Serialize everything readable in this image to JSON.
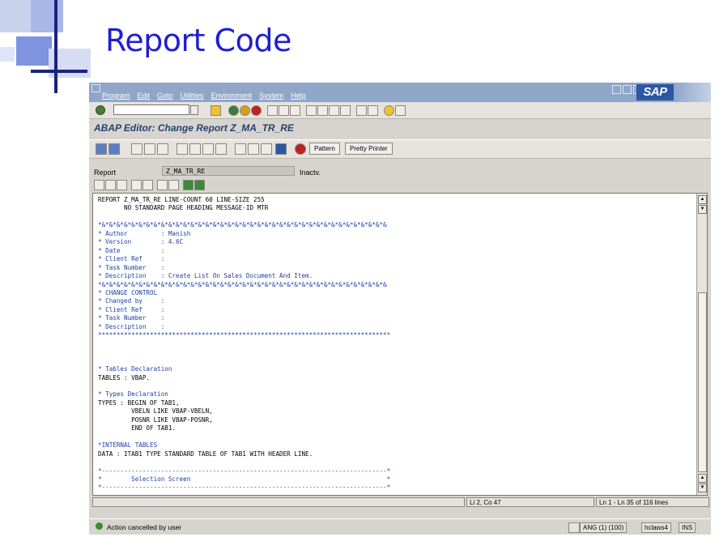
{
  "slide": {
    "title": "Report Code"
  },
  "menu": {
    "items": [
      "Program",
      "Edit",
      "Goto",
      "Utilities",
      "Environment",
      "System",
      "Help"
    ],
    "logo": "SAP"
  },
  "page": {
    "title": "ABAP Editor: Change Report Z_MA_TR_RE"
  },
  "toolbar": {
    "pattern": "Pattern",
    "pretty_printer": "Pretty Printer"
  },
  "report": {
    "label": "Report",
    "value": "Z_MA_TR_RE",
    "status": "Inactv."
  },
  "editor": {
    "lines": [
      "REPORT Z_MA_TR_RE LINE-COUNT 60 LINE-SIZE 255",
      "       NO STANDARD PAGE HEADING MESSAGE-ID MTR",
      "",
      "*&*&*&*&*&*&*&*&*&*&*&*&*&*&*&*&*&*&*&*&*&*&*&*&*&*&*&*&*&*&*&*&*&*&*&*&*&*&*&",
      "* Author         : Manish",
      "* Version        : 4.6C",
      "* Date           :",
      "* Client Ref     :",
      "* Task Number    :",
      "* Description    : Create List On Sales Document And Item.",
      "*&*&*&*&*&*&*&*&*&*&*&*&*&*&*&*&*&*&*&*&*&*&*&*&*&*&*&*&*&*&*&*&*&*&*&*&*&*&*&",
      "* CHANGE CONTROL",
      "* Changed by     :",
      "* Client Ref     :",
      "* Task Number    :",
      "* Description    :",
      "*******************************************************************************",
      "",
      "",
      "",
      "* Tables Declaration",
      "TABLES : VBAP.",
      "",
      "* Types Declaration",
      "TYPES : BEGIN OF TAB1,",
      "         VBELN LIKE VBAP-VBELN,",
      "         POSNR LIKE VBAP-POSNR,",
      "         END OF TAB1.",
      "",
      "*INTERNAL TABLES",
      "DATA : ITAB1 TYPE STANDARD TABLE OF TAB1 WITH HEADER LINE.",
      "",
      "*-----------------------------------------------------------------------------*",
      "*        Selection Screen                                                     *",
      "*-----------------------------------------------------------------------------*"
    ]
  },
  "status": {
    "position": "Li 2, Co 47",
    "lines": "Ln 1 - Ln 35 of 116 lines"
  },
  "message": {
    "text": "Action cancelled by user"
  },
  "system": {
    "session": "ANG (1) (100)",
    "server": "hclaws4",
    "mode": "INS"
  }
}
